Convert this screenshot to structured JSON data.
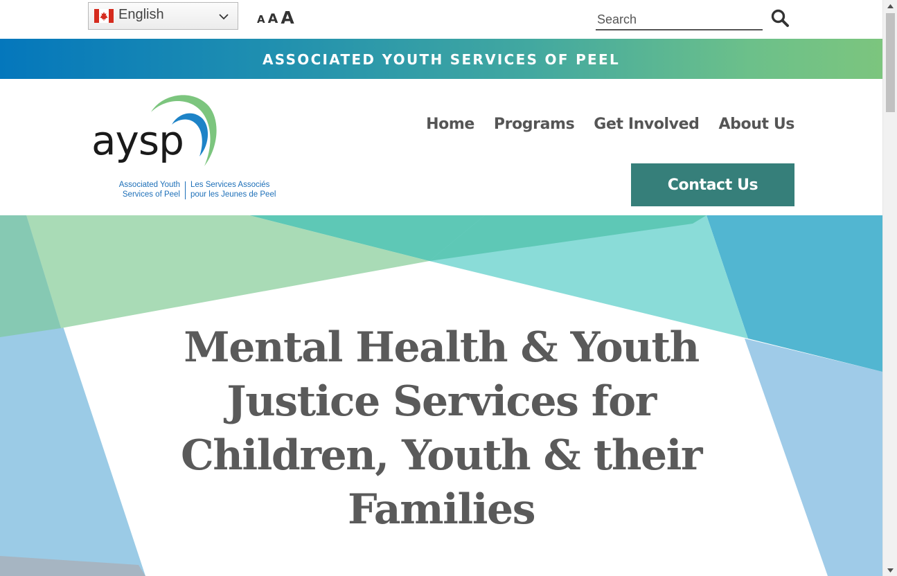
{
  "language_select": {
    "selected": "English",
    "flag_icon": "canada-flag-icon"
  },
  "font_sizer": {
    "small": "A",
    "medium": "A",
    "large": "A"
  },
  "search": {
    "placeholder": "Search",
    "value": "",
    "icon": "search-icon"
  },
  "banner": {
    "text": "ASSOCIATED YOUTH SERVICES OF PEEL"
  },
  "logo": {
    "wordmark": "aysp",
    "subtitle_en_line1": "Associated Youth",
    "subtitle_en_line2": "Services of Peel",
    "subtitle_fr_line1": "Les Services Associés",
    "subtitle_fr_line2": "pour les Jeunes de Peel"
  },
  "nav": {
    "items": [
      {
        "label": "Home"
      },
      {
        "label": "Programs"
      },
      {
        "label": "Get Involved"
      },
      {
        "label": "About Us"
      }
    ],
    "contact_label": "Contact Us"
  },
  "hero": {
    "title": "Mental Health & Youth Justice Services for Children, Youth & their Families"
  },
  "colors": {
    "banner_gradient_start": "#0477bc",
    "banner_gradient_end": "#7cc57e",
    "contact_button": "#367f7a",
    "nav_text": "#555555",
    "hero_text": "#5a5a5a",
    "logo_blue": "#1d6fb8",
    "logo_green": "#7cc57e"
  }
}
